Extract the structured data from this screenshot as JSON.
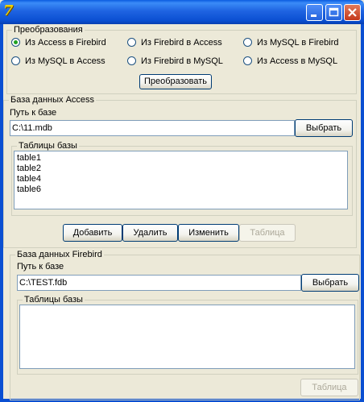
{
  "titlebar": {
    "icon": "delphi-app-icon",
    "minimize": "0",
    "maximize": "1",
    "close": "r"
  },
  "conversion": {
    "legend": "Преобразования",
    "options": [
      "Из Access в Firebird",
      "Из Firebird в Access",
      "Из MySQL в Firebird",
      "Из MySQL в Access",
      "Из Firebird в MySQL",
      "Из Access в MySQL"
    ],
    "selected": "Из Access в Firebird",
    "convert_button": "Преобразовать"
  },
  "access": {
    "legend": "База данных Access",
    "path_label": "Путь к базе",
    "path_value": "C:\\11.mdb",
    "browse_button": "Выбрать",
    "tables_legend": "Таблицы базы",
    "tables": [
      "table1",
      "table2",
      "table4",
      "table6"
    ],
    "add_button": "Добавить",
    "delete_button": "Удалить",
    "edit_button": "Изменить",
    "table_button": "Таблица"
  },
  "firebird": {
    "legend": "База данных Firebird",
    "path_label": "Путь к базе",
    "path_value": "C:\\TEST.fdb",
    "browse_button": "Выбрать",
    "tables_legend": "Таблицы базы",
    "tables": [],
    "table_button": "Таблица"
  }
}
